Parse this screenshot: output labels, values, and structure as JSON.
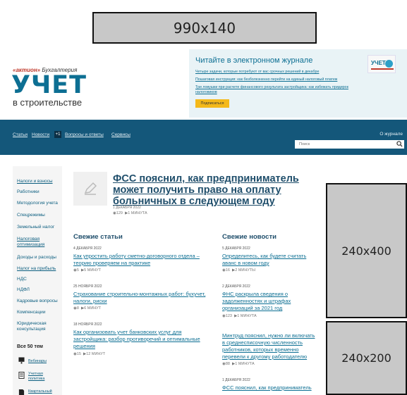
{
  "banner_top": "990x140",
  "brand": {
    "publisher": "«актион»",
    "section": "Бухгалтерия",
    "logo": "УЧЕТ",
    "subtitle": "в строительстве"
  },
  "promo": {
    "title": "Читайте в электронном журнале",
    "links": [
      "Четыре задачи, которые потребуют от вас срочных решений в декабре",
      "Пошаговая инструкция: как безболезненно перейти на единый налоговый платеж",
      "Три ловушки при расчете финансового результата застройщика: как избежать придирок",
      "налоговиков"
    ],
    "button": "Подписаться",
    "journal_label": "УЧЕТ"
  },
  "nav": {
    "items": [
      "Статьи",
      "Новости",
      "Вопросы и ответы",
      "Сервисы"
    ],
    "news_badge": "+1",
    "right": "О журнале",
    "search_placeholder": "Поиск"
  },
  "sidebar": {
    "items": [
      "Налоги и взносы",
      "Работники",
      "Методология учета",
      "Спецрежимы",
      "Земельный налог",
      "Налоговая оптимизация",
      "Доходы и расходы",
      "Налог на прибыль",
      "НДС",
      "НДФЛ",
      "Кадровые вопросы",
      "Компенсации",
      "Юридическая консультация"
    ],
    "all": "Все 50 тем",
    "icons": [
      {
        "icon": "webinar-icon",
        "label": "Вебинары"
      },
      {
        "icon": "policy-icon",
        "label": "Учетная политика"
      },
      {
        "icon": "report-icon",
        "label": "Квартальный"
      }
    ]
  },
  "featured": {
    "title": "ФСС пояснил, как предприниматель может получить право на оплату больничных в следующем году",
    "date": "1 ДЕКАБРЯ 2022",
    "views": "129",
    "read": "1 МИНУТА"
  },
  "articles": {
    "title": "Свежие статьи",
    "items": [
      {
        "date": "4 ДЕКАБРЯ 2022",
        "lines": [
          "Как упростить работу сметно-договорного отдела –",
          "теорию проверяем на практике"
        ],
        "views": "5",
        "read": "5 МИНУТ"
      },
      {
        "date": "25 НОЯБРЯ 2022",
        "lines": [
          "Страхование строительно-монтажных работ: бухучет,",
          "налоги, риски"
        ],
        "views": "8",
        "read": "6 МИНУТ"
      },
      {
        "date": "18 НОЯБРЯ 2022",
        "lines": [
          "Как организовать учет банковских услуг для",
          "застройщика: разбор противоречий и оптимальные",
          "решения"
        ],
        "views": "15",
        "read": "12 МИНУТ"
      }
    ]
  },
  "news": {
    "title": "Свежие новости",
    "items": [
      {
        "date": "5 ДЕКАБРЯ 2022",
        "lines": [
          "Определитесь, как будете считать",
          "аванс в новом году"
        ],
        "views": "16",
        "read": "2 МИНУТЫ"
      },
      {
        "date": "2 ДЕКАБРЯ 2022",
        "lines": [
          "ФНС раскрыла сведения о",
          "задолженностях и штрафах",
          "организаций за 2021 год"
        ],
        "views": "123",
        "read": "1 МИНУТА"
      },
      {
        "date": "",
        "lines": [
          "Минтруд пояснил, нужно ли включать",
          "в среднесписочную численность",
          "работников, которых временно",
          "перевели к другому работодателю"
        ],
        "views": "88",
        "read": "1 МИНУТА"
      },
      {
        "date": "1 ДЕКАБРЯ 2022",
        "lines": [
          "ФСС пояснил, как предприниматель"
        ],
        "views": "",
        "read": ""
      }
    ]
  },
  "ads": {
    "right_top": "240x400",
    "right_bottom": "240x200"
  }
}
